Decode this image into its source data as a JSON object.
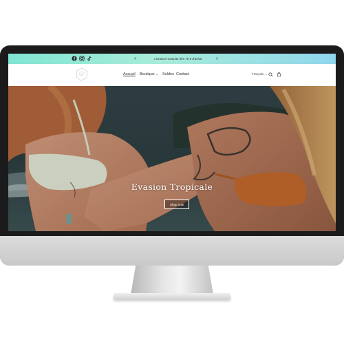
{
  "announcement": {
    "text": "Livraison Gratuite dès 70 € d'achat"
  },
  "nav": {
    "items": [
      {
        "label": "Accueil",
        "active": true
      },
      {
        "label": "Boutique",
        "has_dropdown": true
      },
      {
        "label": "Soldes"
      },
      {
        "label": "Contact"
      }
    ]
  },
  "header": {
    "language": "Français"
  },
  "hero": {
    "title": "Evasion Tropicale",
    "button_label": "Shop now"
  },
  "icons": {
    "social": [
      "facebook-icon",
      "instagram-icon",
      "tiktok-icon"
    ],
    "header_right": [
      "search-icon",
      "cart-icon"
    ],
    "announcement_prev": "chevron-left-icon",
    "announcement_next": "chevron-right-icon"
  },
  "colors": {
    "announcement_bar_start": "#7fe5d2",
    "announcement_bar_end": "#8fd6ec",
    "monitor_bezel": "#1b1b1b",
    "monitor_chin": "#d3d3d3"
  }
}
